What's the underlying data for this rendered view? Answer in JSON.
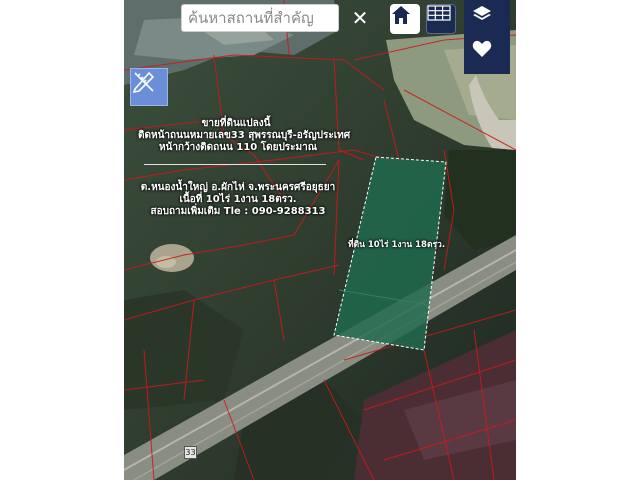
{
  "search": {
    "placeholder": "ค้นหาสถานที่สำคัญ"
  },
  "buttons": {
    "clear_icon": "close-icon",
    "home_icon": "home-icon",
    "grid_icon": "grid-icon",
    "layers_icon": "layers-icon",
    "favorite_icon": "heart-icon",
    "draw_icon": "pencil-ruler-icon"
  },
  "listing": {
    "heading": "ขายที่ดินแปลงนี้",
    "line1": "ติดหน้าถนนหมายเลข33 สุพรรณบุรี-อรัญประเทศ",
    "line2": "หน้ากว้างติดถนน 110 โดยประมาณ",
    "line3": "ต.หนองน้ำใหญ่ อ.ผักไห่ จ.พระนครศรีอยุธยา",
    "line4": "เนื้อที่ 10ไร่ 1งาน 18ตรว.",
    "line5": "สอบถามเพิ่มเติม Tle : 090-9288313"
  },
  "plot_label": "ที่ดิน 10ไร่ 1งาน 18ตรว.",
  "road_number": "33",
  "colors": {
    "panel": "#1a2a52",
    "plot_fill": "#1f6b4e",
    "parcel_line": "#d01818",
    "draw_button": "#6a8ed8"
  }
}
